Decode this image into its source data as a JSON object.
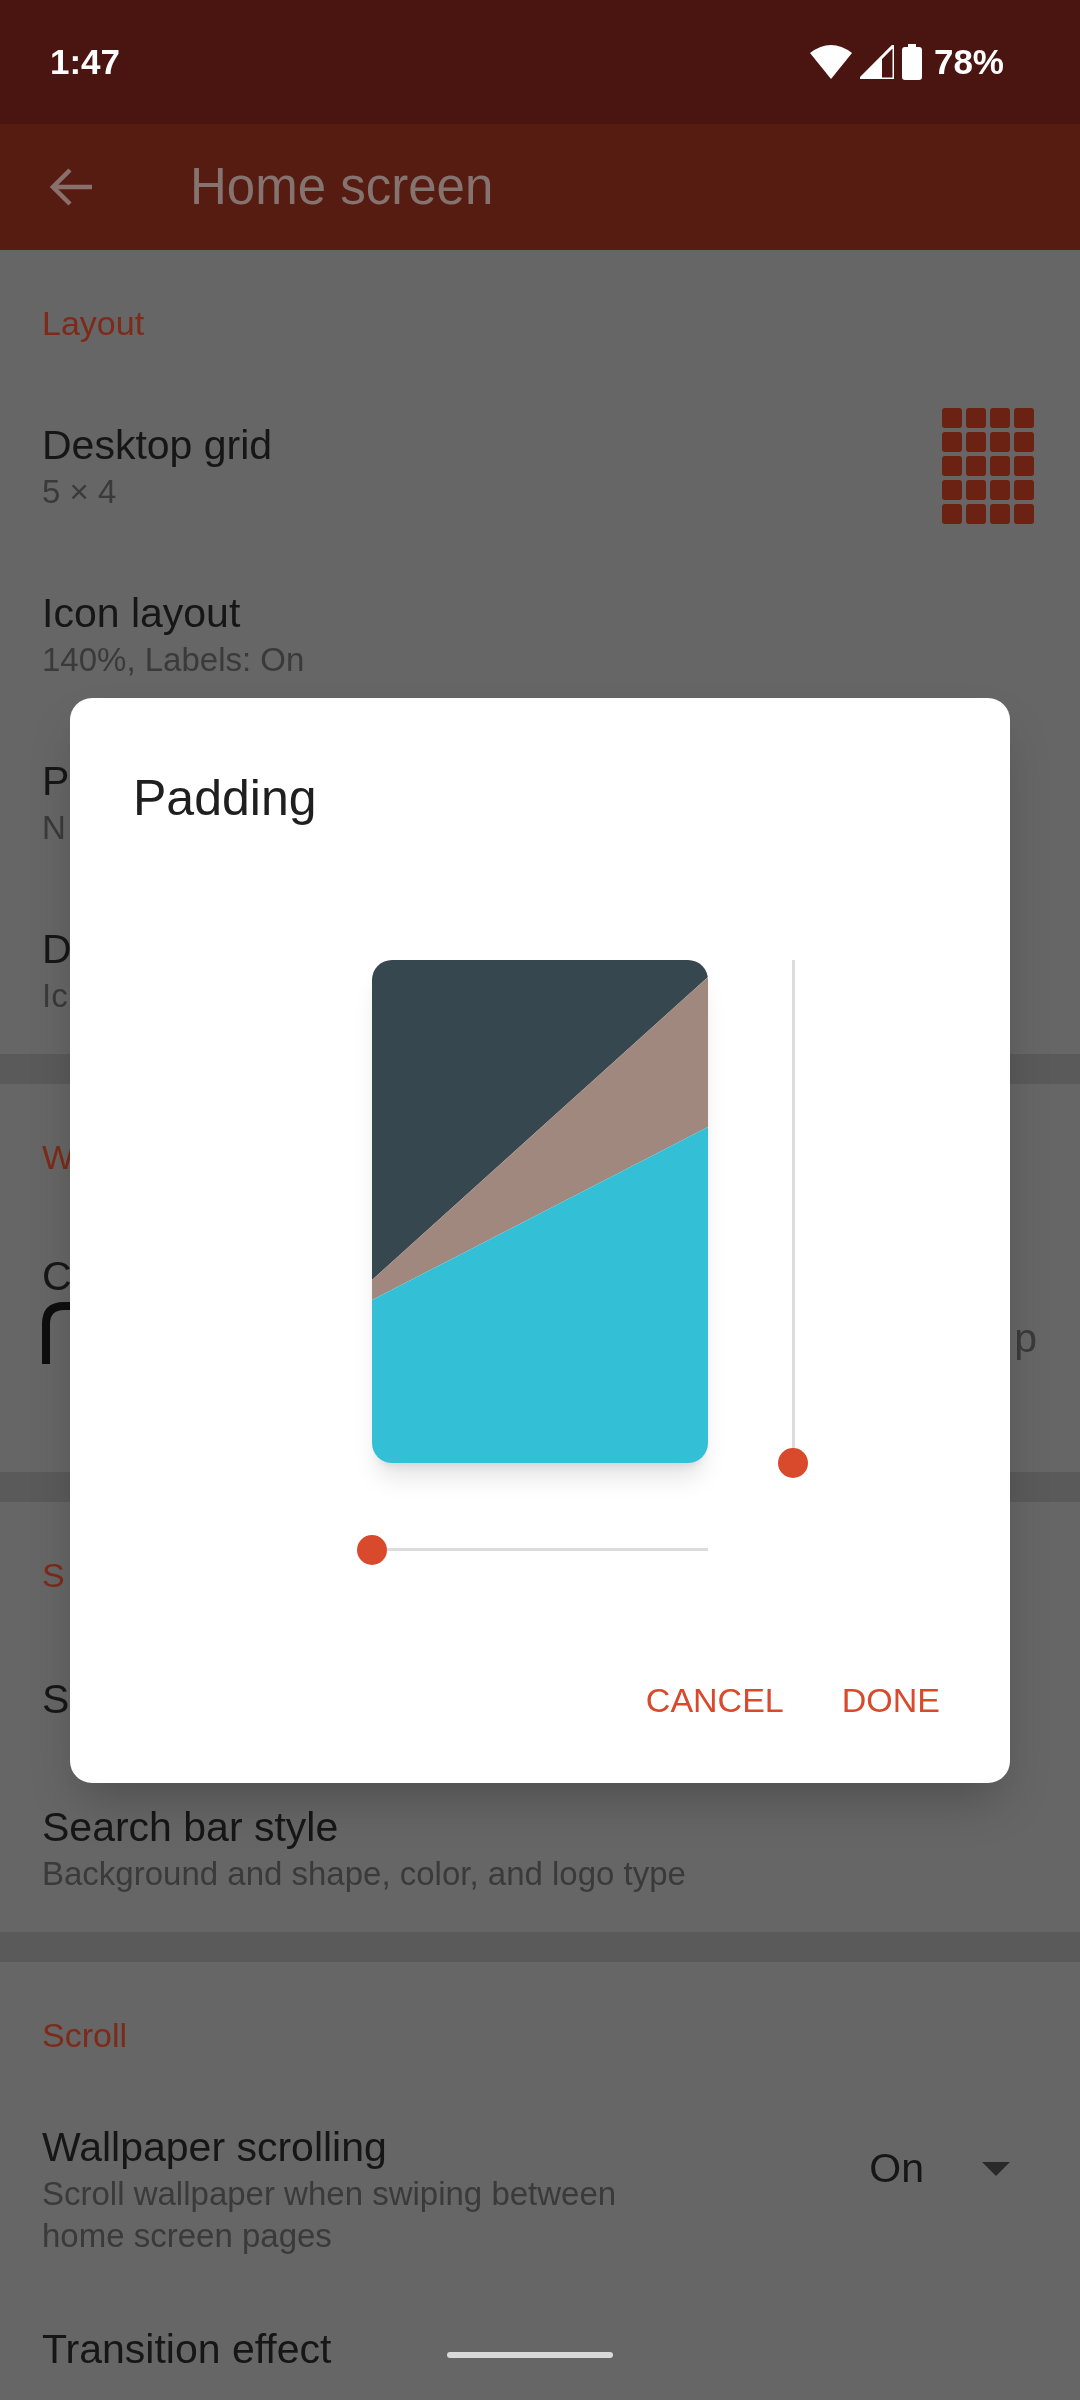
{
  "status_bar": {
    "time": "1:47",
    "battery": "78%"
  },
  "app_bar": {
    "title": "Home screen"
  },
  "sections": [
    {
      "header": "Layout",
      "items": [
        {
          "kind": "grid",
          "title": "Desktop grid",
          "subtitle": "5 × 4"
        },
        {
          "kind": "plain",
          "title": "Icon layout",
          "subtitle": "140%, Labels: On"
        },
        {
          "kind": "plain",
          "title": "P",
          "subtitle": "N"
        },
        {
          "kind": "plain",
          "title": "D",
          "subtitle": "Ic"
        }
      ]
    },
    {
      "header": "W",
      "items": [
        {
          "kind": "preview",
          "title": "C",
          "trailing": "p"
        }
      ]
    },
    {
      "header": "S",
      "items": [
        {
          "kind": "plain",
          "title": "S"
        },
        {
          "kind": "plain",
          "title": "Search bar style",
          "subtitle": "Background and shape, color, and logo type"
        }
      ]
    },
    {
      "header": "Scroll",
      "items": [
        {
          "kind": "dropdown",
          "title": "Wallpaper scrolling",
          "subtitle": "Scroll wallpaper when swiping between home screen pages",
          "value": "On"
        },
        {
          "kind": "plain",
          "title": "Transition effect"
        }
      ]
    }
  ],
  "dialog": {
    "title": "Padding",
    "vertical_slider": {
      "level": 0
    },
    "horizontal_slider": {
      "level": 0
    },
    "buttons": [
      "CANCEL",
      "DONE"
    ]
  }
}
